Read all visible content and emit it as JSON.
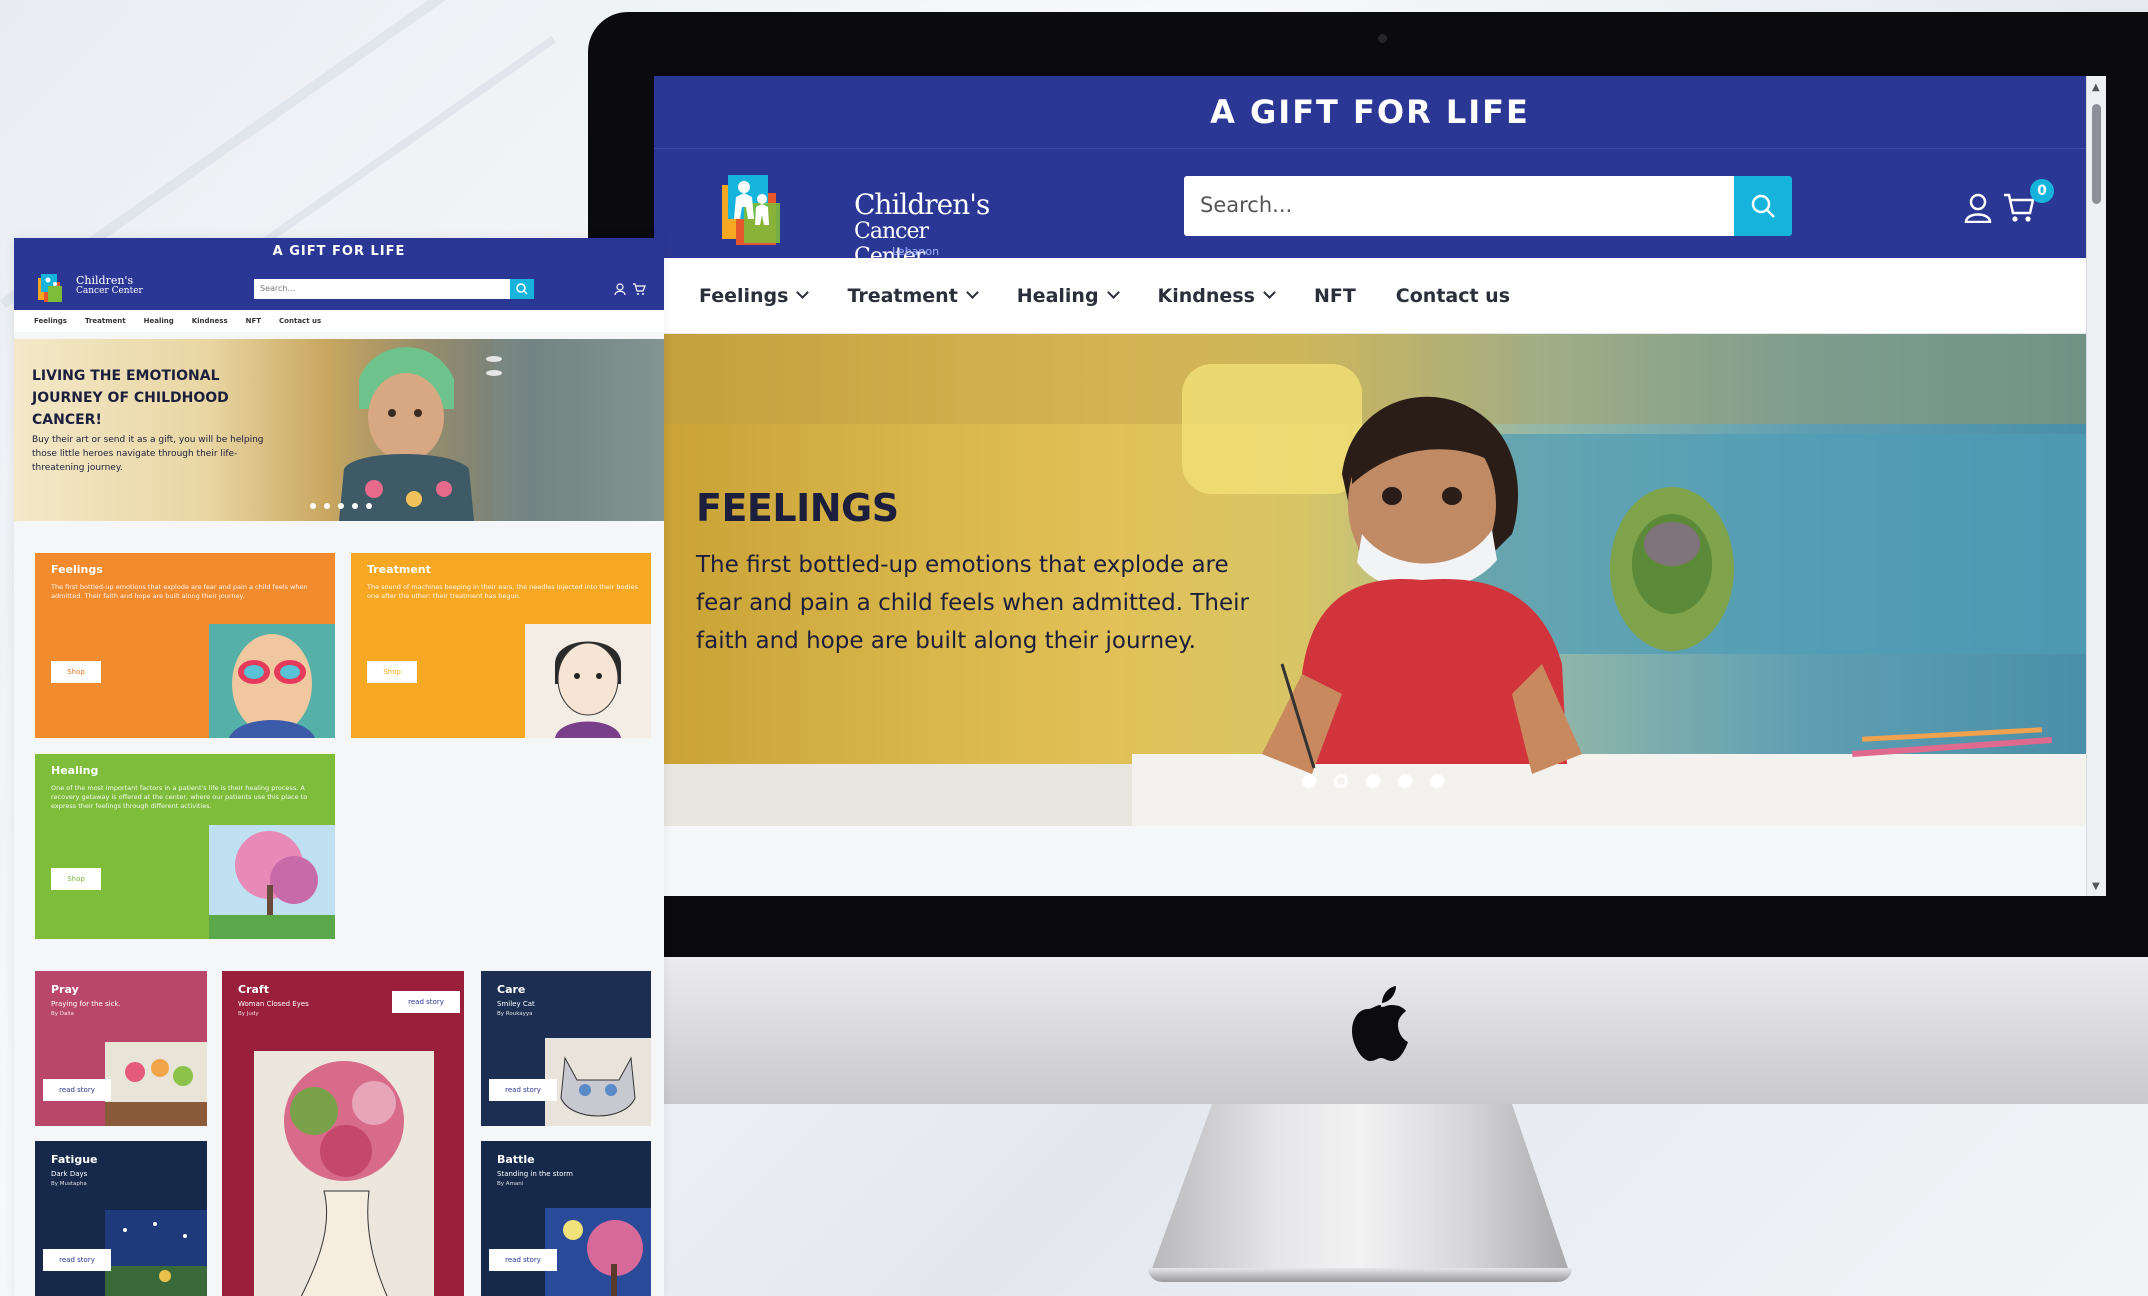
{
  "desktop": {
    "announcement": "A GIFT FOR LIFE",
    "logo": {
      "name": "Children's",
      "subname": "Cancer Center",
      "tagline": "Lebanon"
    },
    "search": {
      "placeholder": "Search..."
    },
    "cart": {
      "count": "0"
    },
    "nav": [
      {
        "label": "Feelings",
        "has_dropdown": true
      },
      {
        "label": "Treatment",
        "has_dropdown": true
      },
      {
        "label": "Healing",
        "has_dropdown": true
      },
      {
        "label": "Kindness",
        "has_dropdown": true
      },
      {
        "label": "NFT",
        "has_dropdown": false
      },
      {
        "label": "Contact us",
        "has_dropdown": false
      }
    ],
    "hero": {
      "title": "FEELINGS",
      "text": "The first bottled-up emotions that explode are fear and pain a child feels when admitted. Their faith and hope are built along their journey."
    }
  },
  "mobile_preview": {
    "announcement": "A GIFT FOR LIFE",
    "logo": {
      "name": "Children's",
      "subname": "Cancer Center"
    },
    "search": {
      "placeholder": "Search..."
    },
    "nav": [
      "Feelings",
      "Treatment",
      "Healing",
      "Kindness",
      "NFT",
      "Contact us"
    ],
    "hero": {
      "title": "LIVING THE EMOTIONAL JOURNEY OF CHILDHOOD CANCER!",
      "text": "Buy their art or send it as a gift, you will be helping those little heroes navigate through their life-threatening journey."
    },
    "categories": [
      {
        "title": "Feelings",
        "text": "The first bottled-up emotions that explode are fear and pain a child feels when admitted. Their faith and hope are built along their journey.",
        "button": "Shop",
        "color": "#f28a2e"
      },
      {
        "title": "Treatment",
        "text": "The sound of machines beeping in their ears, the needles injected into their bodies one after the other: their treatment has begun.",
        "button": "Shop",
        "color": "#f7a823"
      },
      {
        "title": "Healing",
        "text": "One of the most important factors in a patient's life is their healing process. A recovery getaway is offered at the center, where our patients use this place to express their feelings through different activities.",
        "button": "Shop",
        "color": "#7dbd3a"
      }
    ],
    "stories": [
      {
        "title": "Pray",
        "subtitle": "Praying for the sick.",
        "by": "By Dalia",
        "button": "read story",
        "color": "#b8476b"
      },
      {
        "title": "Craft",
        "subtitle": "Woman Closed Eyes",
        "by": "By Judy",
        "button": "read story",
        "color": "#9a1f3a"
      },
      {
        "title": "Care",
        "subtitle": "Smiley Cat",
        "by": "By Roukayya",
        "button": "read story",
        "color": "#1c2f52"
      },
      {
        "title": "Fatigue",
        "subtitle": "Dark Days",
        "by": "By Mustapha",
        "button": "read story",
        "color": "#16294b"
      },
      {
        "title": "Battle",
        "subtitle": "Standing in the storm",
        "by": "By Amani",
        "button": "read story",
        "color": "#17294a"
      }
    ]
  }
}
